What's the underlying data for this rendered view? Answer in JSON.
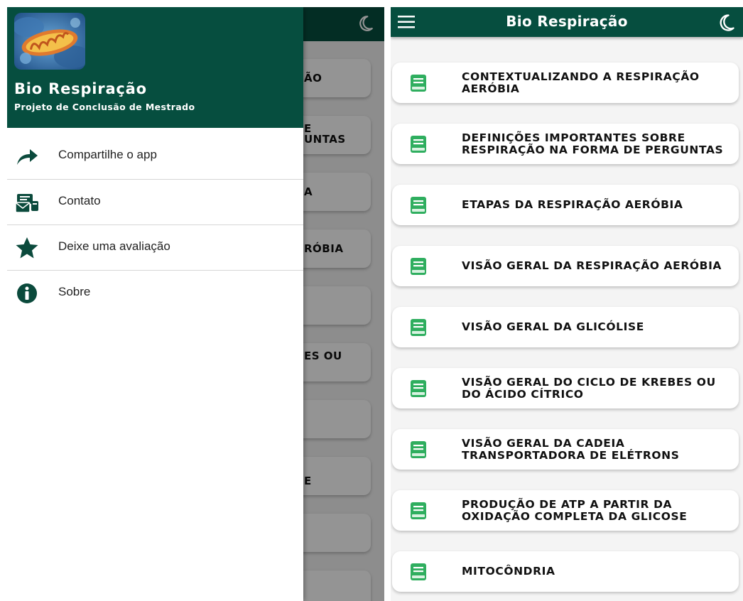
{
  "left_screen": {
    "background_cards": [
      {
        "text": "ÃO"
      },
      {
        "text": "E\nUNTAS"
      },
      {
        "text": "A"
      },
      {
        "text": "RÓBIA"
      },
      {
        "text": ""
      },
      {
        "text": "ES OU"
      },
      {
        "text": ""
      },
      {
        "text": "E"
      },
      {
        "text": ""
      },
      {
        "text": ""
      }
    ],
    "drawer": {
      "title": "Bio Respiração",
      "subtitle": "Projeto de Conclusão de Mestrado",
      "items": [
        {
          "label": "Compartilhe o app",
          "icon": "share-icon"
        },
        {
          "label": "Contato",
          "icon": "contact-icon"
        },
        {
          "label": "Deixe uma avaliação",
          "icon": "star-icon"
        },
        {
          "label": "Sobre",
          "icon": "info-icon"
        }
      ]
    }
  },
  "right_screen": {
    "app_title": "Bio Respiração",
    "topics": [
      {
        "label": "CONTEXTUALIZANDO A RESPIRAÇÃO\nAERÓBIA"
      },
      {
        "label": "DEFINIÇÕES IMPORTANTES SOBRE\nRESPIRAÇÃO NA FORMA DE PERGUNTAS"
      },
      {
        "label": "ETAPAS DA RESPIRAÇÃO AERÓBIA"
      },
      {
        "label": "VISÃO GERAL DA RESPIRAÇÃO AERÓBIA"
      },
      {
        "label": "VISÃO GERAL DA GLICÓLISE"
      },
      {
        "label": "VISÃO GERAL DO CICLO DE KREBES OU\nDO ÁCIDO CÍTRICO"
      },
      {
        "label": "VISÃO GERAL DA CADEIA\nTRANSPORTADORA DE ELÉTRONS"
      },
      {
        "label": "PRODUÇÃO DE ATP A PARTIR DA\nOXIDAÇÃO COMPLETA DA GLICOSE"
      },
      {
        "label": "MITOCÔNDRIA"
      }
    ]
  },
  "colors": {
    "primary": "#064e3f",
    "icon_green": "#2fae5f",
    "drawer_icon": "#0b4a3c"
  }
}
